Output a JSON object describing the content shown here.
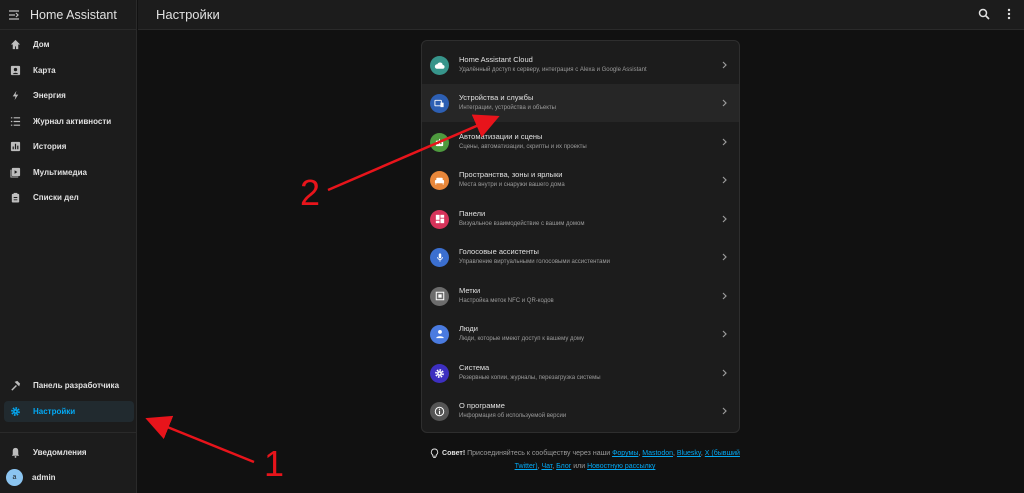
{
  "sidebar": {
    "title": "Home Assistant",
    "items": [
      {
        "label": "Дом",
        "icon": "home-icon"
      },
      {
        "label": "Карта",
        "icon": "map-icon"
      },
      {
        "label": "Энергия",
        "icon": "lightning-icon"
      },
      {
        "label": "Журнал активности",
        "icon": "list-icon"
      },
      {
        "label": "История",
        "icon": "chart-icon"
      },
      {
        "label": "Мультимедиа",
        "icon": "play-icon"
      },
      {
        "label": "Списки дел",
        "icon": "clipboard-icon"
      }
    ],
    "dev_tools": "Панель разработчика",
    "settings": "Настройки",
    "notifications": "Уведомления",
    "user_initial": "a",
    "user": "admin"
  },
  "header": {
    "title": "Настройки"
  },
  "settings_list": [
    {
      "title": "Home Assistant Cloud",
      "subtitle": "Удалённый доступ к серверу, интеграция с Alexa и Google Assistant",
      "color": "#37958b",
      "icon": "cloud-icon"
    },
    {
      "title": "Устройства и службы",
      "subtitle": "Интеграции, устройства и объекты",
      "color": "#2d5fb3",
      "icon": "devices-icon"
    },
    {
      "title": "Автоматизации и сцены",
      "subtitle": "Сцены, автоматизации, скрипты и их проекты",
      "color": "#4e9a3e",
      "icon": "robot-icon"
    },
    {
      "title": "Пространства, зоны и ярлыки",
      "subtitle": "Места внутри и снаружи вашего дома",
      "color": "#e8873a",
      "icon": "sofa-icon"
    },
    {
      "title": "Панели",
      "subtitle": "Визуальное взаимодействие с вашим домом",
      "color": "#d6335a",
      "icon": "dashboard-icon"
    },
    {
      "title": "Голосовые ассистенты",
      "subtitle": "Управление виртуальными голосовыми ассистентами",
      "color": "#3b6fd0",
      "icon": "microphone-icon"
    },
    {
      "title": "Метки",
      "subtitle": "Настройка меток NFC и QR-кодов",
      "color": "#6c6c6c",
      "icon": "tag-icon"
    },
    {
      "title": "Люди",
      "subtitle": "Люди, которые имеют доступ к вашему дому",
      "color": "#4a7be0",
      "icon": "person-icon"
    },
    {
      "title": "Система",
      "subtitle": "Резервные копии, журналы, перезагрузка системы",
      "color": "#3d2fc0",
      "icon": "gear-icon"
    },
    {
      "title": "О программе",
      "subtitle": "Информация об используемой версии",
      "color": "#555555",
      "icon": "info-icon"
    }
  ],
  "tip": {
    "label": "Совет!",
    "text1": "Присоединяйтесь к сообществу через наши",
    "forums": "Форумы",
    "mastodon": "Mastodon",
    "bluesky": "Bluesky",
    "x": "X (бывший Twitter)",
    "chat": "Чат",
    "blog": "Блог",
    "or": "или",
    "newsletter": "Новостную рассылку"
  },
  "annotations": {
    "one": "1",
    "two": "2"
  },
  "colors": {
    "accent": "#03a9f4",
    "arrow": "#e8141b"
  }
}
